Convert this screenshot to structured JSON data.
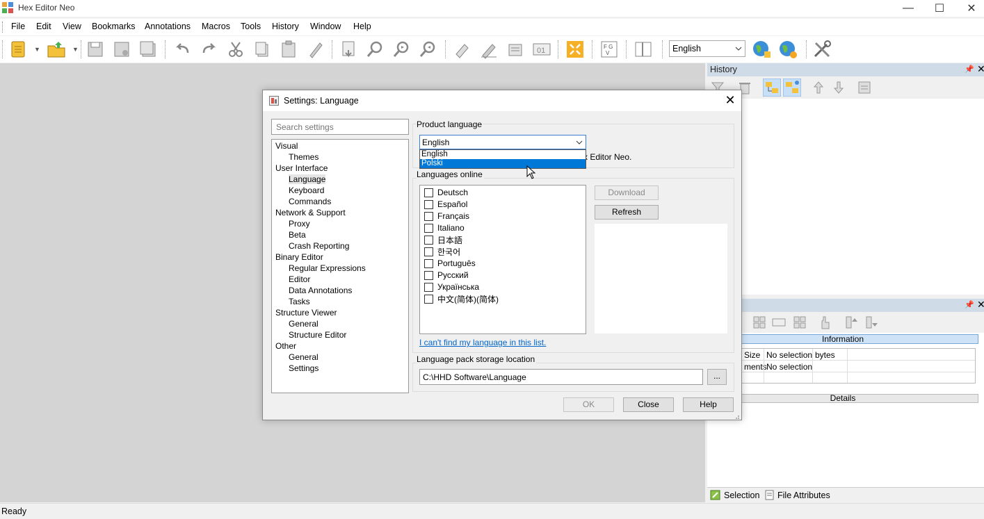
{
  "app": {
    "title": "Hex Editor Neo"
  },
  "menu": [
    "File",
    "Edit",
    "View",
    "Bookmarks",
    "Annotations",
    "Macros",
    "Tools",
    "History",
    "Window",
    "Help"
  ],
  "toolbar": {
    "language_value": "English"
  },
  "history_panel": {
    "title": "History"
  },
  "selection_panel": {
    "info_header": "Information",
    "rows": [
      {
        "label": "Size",
        "value": "No selection",
        "unit": "bytes"
      },
      {
        "label": "ments",
        "value": "No selection",
        "unit": ""
      }
    ],
    "details_header": "Details",
    "tabs": [
      "Selection",
      "File Attributes"
    ]
  },
  "status": {
    "text": "Ready"
  },
  "dialog": {
    "title": "Settings: Language",
    "search_placeholder": "Search settings",
    "tree": [
      {
        "label": "Visual",
        "level": 0
      },
      {
        "label": "Themes",
        "level": 1
      },
      {
        "label": "User Interface",
        "level": 0
      },
      {
        "label": "Language",
        "level": 1,
        "selected": true
      },
      {
        "label": "Keyboard",
        "level": 1
      },
      {
        "label": "Commands",
        "level": 1
      },
      {
        "label": "Network & Support",
        "level": 0
      },
      {
        "label": "Proxy",
        "level": 1
      },
      {
        "label": "Beta",
        "level": 1
      },
      {
        "label": "Crash Reporting",
        "level": 1
      },
      {
        "label": "Binary Editor",
        "level": 0
      },
      {
        "label": "Regular Expressions",
        "level": 1
      },
      {
        "label": "Editor",
        "level": 1
      },
      {
        "label": "Data Annotations",
        "level": 1
      },
      {
        "label": "Tasks",
        "level": 1
      },
      {
        "label": "Structure Viewer",
        "level": 0
      },
      {
        "label": "General",
        "level": 1
      },
      {
        "label": "Structure Editor",
        "level": 1
      },
      {
        "label": "Other",
        "level": 0
      },
      {
        "label": "General",
        "level": 1
      },
      {
        "label": "Settings",
        "level": 1
      }
    ],
    "product_language": {
      "label": "Product language",
      "value": "English",
      "options": [
        "English",
        "Polski"
      ],
      "highlighted": "Polski",
      "desc_fragment": "x Editor Neo."
    },
    "languages_online": {
      "label": "Languages online",
      "items": [
        "Deutsch",
        "Español",
        "Français",
        "Italiano",
        "日本語",
        "한국어",
        "Português",
        "Русский",
        "Українська",
        "中文(简体)(简体)"
      ],
      "download_label": "Download",
      "refresh_label": "Refresh",
      "cant_find_link": "I can't find my language in this list."
    },
    "storage": {
      "label": "Language pack storage location",
      "path": "C:\\HHD Software\\Language",
      "browse_label": "..."
    },
    "buttons": {
      "ok": "OK",
      "close": "Close",
      "help": "Help"
    }
  }
}
